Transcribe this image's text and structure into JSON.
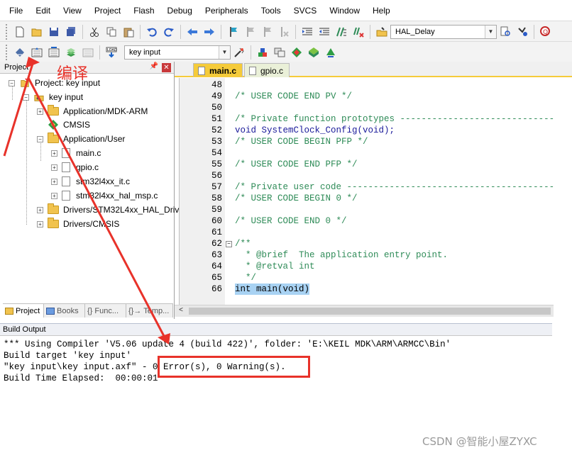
{
  "menu": [
    "File",
    "Edit",
    "View",
    "Project",
    "Flash",
    "Debug",
    "Peripherals",
    "Tools",
    "SVCS",
    "Window",
    "Help"
  ],
  "toolbar1": {
    "function_combo": "HAL_Delay"
  },
  "toolbar2": {
    "target_combo": "key input"
  },
  "project_panel": {
    "title": "Project",
    "tree": [
      {
        "label": "Project: key input"
      },
      {
        "label": "key input"
      },
      {
        "label": "Application/MDK-ARM"
      },
      {
        "label": "CMSIS"
      },
      {
        "label": "Application/User"
      },
      {
        "label": "main.c"
      },
      {
        "label": "gpio.c"
      },
      {
        "label": "stm32l4xx_it.c"
      },
      {
        "label": "stm32l4xx_hal_msp.c"
      },
      {
        "label": "Drivers/STM32L4xx_HAL_Driv"
      },
      {
        "label": "Drivers/CMSIS"
      }
    ],
    "tabs": [
      "Project",
      "Books",
      "{} Func...",
      "{}→ Temp..."
    ]
  },
  "editor": {
    "tabs": [
      "main.c",
      "gpio.c"
    ],
    "lines": [
      {
        "num": "48",
        "text": ""
      },
      {
        "num": "49",
        "text": "/* USER CODE END PV */"
      },
      {
        "num": "50",
        "text": ""
      },
      {
        "num": "51",
        "text": "/* Private function prototypes -----------------------------------------------"
      },
      {
        "num": "52",
        "text": "void SystemClock_Config(void);"
      },
      {
        "num": "53",
        "text": "/* USER CODE BEGIN PFP */"
      },
      {
        "num": "54",
        "text": ""
      },
      {
        "num": "55",
        "text": "/* USER CODE END PFP */"
      },
      {
        "num": "56",
        "text": ""
      },
      {
        "num": "57",
        "text": "/* Private user code ---------------------------------------------------------"
      },
      {
        "num": "58",
        "text": "/* USER CODE BEGIN 0 */"
      },
      {
        "num": "59",
        "text": ""
      },
      {
        "num": "60",
        "text": "/* USER CODE END 0 */"
      },
      {
        "num": "61",
        "text": ""
      },
      {
        "num": "62",
        "text": "/**"
      },
      {
        "num": "63",
        "text": "  * @brief  The application entry point."
      },
      {
        "num": "64",
        "text": "  * @retval int"
      },
      {
        "num": "65",
        "text": "  */"
      },
      {
        "num": "66",
        "text": "int main(void)"
      }
    ]
  },
  "build_output": {
    "title": "Build Output",
    "lines": [
      "*** Using Compiler 'V5.06 update 4 (build 422)', folder: 'E:\\KEIL MDK\\ARM\\ARMCC\\Bin'",
      "Build target 'key input'",
      "\"key input\\key input.axf\" - 0 Error(s), 0 Warning(s).",
      "Build Time Elapsed:  00:00:01"
    ]
  },
  "annotation": {
    "label": "编译",
    "color": "#e8322a"
  },
  "watermark": "CSDN @智能小屋ZYXC",
  "colors": {
    "active_tab": "#f5cb3a",
    "comment": "#2e8b57",
    "keyword": "#1a1a9a",
    "highlight": "#a8d2f3"
  }
}
